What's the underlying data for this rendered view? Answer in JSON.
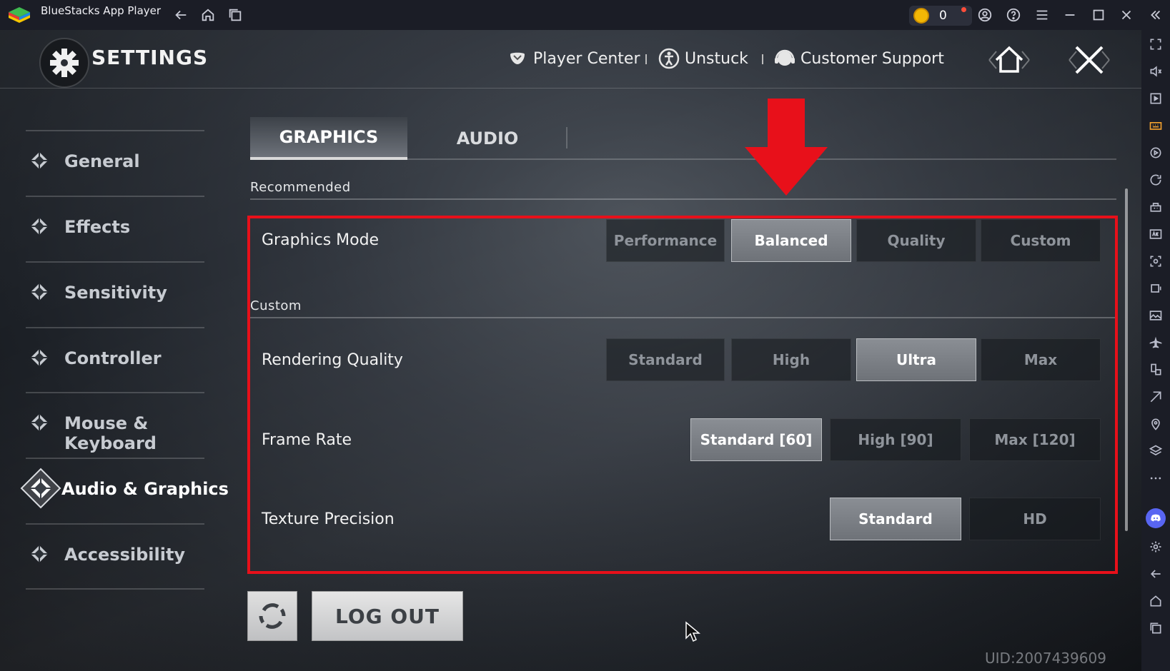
{
  "window": {
    "title": "BlueStacks App Player",
    "coins": "0"
  },
  "header": {
    "title": "SETTINGS",
    "links": {
      "player_center": "Player Center",
      "unstuck": "Unstuck",
      "customer_support": "Customer Support"
    }
  },
  "nav": {
    "items": [
      {
        "label": "General"
      },
      {
        "label": "Effects"
      },
      {
        "label": "Sensitivity"
      },
      {
        "label": "Controller"
      },
      {
        "label": "Mouse & Keyboard"
      },
      {
        "label": "Audio & Graphics",
        "active": true
      },
      {
        "label": "Accessibility"
      }
    ]
  },
  "tabs": [
    {
      "label": "GRAPHICS",
      "active": true
    },
    {
      "label": "AUDIO"
    }
  ],
  "sections": {
    "recommended": "Recommended",
    "custom": "Custom"
  },
  "rows": {
    "graphics_mode": {
      "label": "Graphics Mode",
      "options": [
        "Performance",
        "Balanced",
        "Quality",
        "Custom"
      ],
      "selected": "Balanced"
    },
    "rendering_quality": {
      "label": "Rendering Quality",
      "options": [
        "Standard",
        "High",
        "Ultra",
        "Max"
      ],
      "selected": "Ultra"
    },
    "frame_rate": {
      "label": "Frame Rate",
      "options": [
        "Standard [60]",
        "High [90]",
        "Max [120]"
      ],
      "selected": "Standard [60]"
    },
    "texture_precision": {
      "label": "Texture Precision",
      "options": [
        "Standard",
        "HD"
      ],
      "selected": "Standard"
    }
  },
  "footer": {
    "logout": "LOG OUT",
    "uid": "UID:2007439609"
  },
  "colors": {
    "highlight": "#e8101a",
    "arrow": "#e8101a",
    "selected_option": "#7c8086"
  }
}
